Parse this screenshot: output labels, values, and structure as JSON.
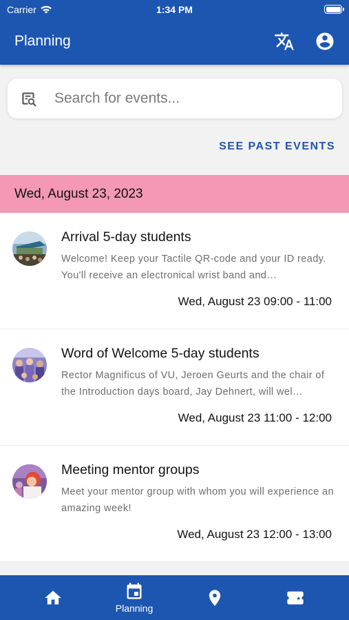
{
  "status_bar": {
    "carrier": "Carrier",
    "time": "1:34 PM"
  },
  "app_bar": {
    "title": "Planning"
  },
  "search": {
    "placeholder": "Search for events..."
  },
  "past_events_link": "SEE PAST EVENTS",
  "date_header": "Wed, August 23, 2023",
  "events": [
    {
      "title": "Arrival 5-day students",
      "description": "Welcome! Keep your Tactile QR-code and your ID ready. You'll receive an electronical wrist band and…",
      "time": "Wed, August 23 09:00 - 11:00"
    },
    {
      "title": "Word of Welcome 5-day students",
      "description": "Rector Magnificus of VU, Jeroen Geurts and the chair of the Introduction days board, Jay Dehnert, will wel…",
      "time": "Wed, August 23 11:00 - 12:00"
    },
    {
      "title": "Meeting mentor groups",
      "description": "Meet your mentor group with whom you will experience an amazing week!",
      "time": "Wed, August 23 12:00 - 13:00"
    }
  ],
  "bottom_nav": [
    {
      "icon": "home-icon",
      "label": ""
    },
    {
      "icon": "calendar-icon",
      "label": "Planning"
    },
    {
      "icon": "location-pin-icon",
      "label": ""
    },
    {
      "icon": "ticket-icon",
      "label": ""
    }
  ],
  "colors": {
    "primary": "#1d56b0",
    "date_header": "#f498b5"
  }
}
